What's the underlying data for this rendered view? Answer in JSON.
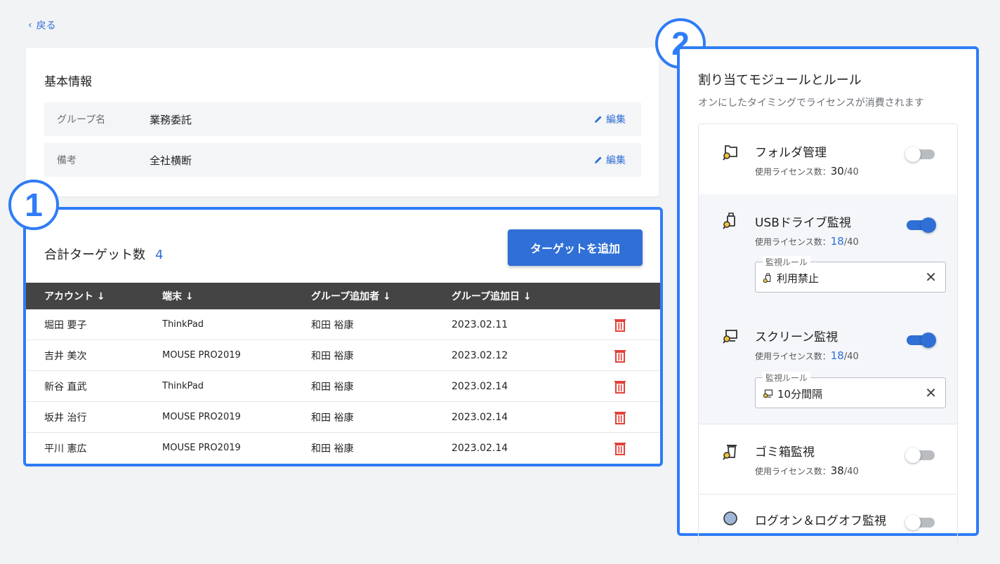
{
  "back": {
    "label": "戻る"
  },
  "basic": {
    "title": "基本情報",
    "rows": [
      {
        "label": "グループ名",
        "value": "業務委託",
        "edit": "編集"
      },
      {
        "label": "備考",
        "value": "全社横断",
        "edit": "編集"
      }
    ]
  },
  "targets": {
    "title": "合計ターゲット数",
    "count": "4",
    "add_button": "ターゲットを追加",
    "columns": [
      "アカウント ↓",
      "端末 ↓",
      "グループ追加者 ↓",
      "グループ追加日 ↓"
    ],
    "rows": [
      {
        "account": "堀田 要子",
        "device": "ThinkPad",
        "added_by": "和田 裕康",
        "date": "2023.02.11"
      },
      {
        "account": "吉井 美次",
        "device": "MOUSE PRO2019",
        "added_by": "和田 裕康",
        "date": "2023.02.12"
      },
      {
        "account": "新谷 直武",
        "device": "ThinkPad",
        "added_by": "和田 裕康",
        "date": "2023.02.14"
      },
      {
        "account": "坂井 治行",
        "device": "MOUSE PRO2019",
        "added_by": "和田 裕康",
        "date": "2023.02.14"
      },
      {
        "account": "平川 憲広",
        "device": "MOUSE PRO2019",
        "added_by": "和田 裕康",
        "date": "2023.02.14"
      }
    ]
  },
  "badges": {
    "one": "1",
    "two": "2"
  },
  "panel": {
    "title": "割り当てモジュールとルール",
    "subtitle": "オンにしたタイミングでライセンスが消費されます",
    "license_label": "使用ライセンス数：",
    "modules": [
      {
        "name": "フォルダ管理",
        "used": "30",
        "total": "/40",
        "enabled": false,
        "icon": "folder-search-icon"
      },
      {
        "name": "USBドライブ監視",
        "used": "18",
        "total": "/40",
        "enabled": true,
        "icon": "usb-search-icon",
        "rule_label": "監視ルール",
        "rule_value": "利用禁止"
      },
      {
        "name": "スクリーン監視",
        "used": "18",
        "total": "/40",
        "enabled": true,
        "icon": "screen-search-icon",
        "rule_label": "監視ルール",
        "rule_value": "10分間隔"
      },
      {
        "name": "ゴミ箱監視",
        "used": "38",
        "total": "/40",
        "enabled": false,
        "icon": "trash-search-icon"
      },
      {
        "name": "ログオン＆ログオフ監視",
        "enabled": false,
        "icon": "logon-search-icon"
      }
    ]
  },
  "colors": {
    "accent": "#2f6fd6",
    "highlight_border": "#2f7cf6",
    "danger": "#e0413a"
  }
}
